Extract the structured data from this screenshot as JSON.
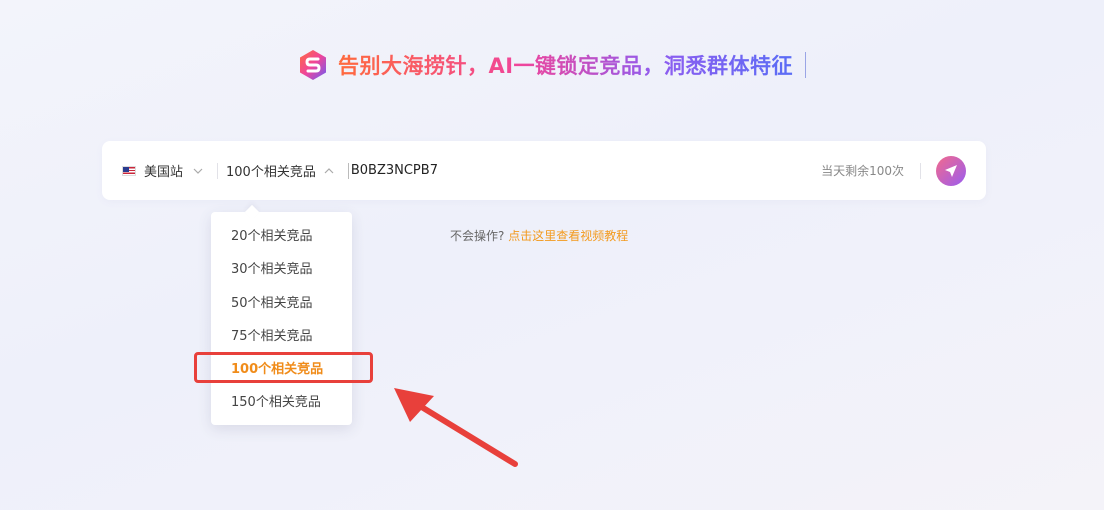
{
  "hero": {
    "title": "告别大海捞针，AI一键锁定竞品，洞悉群体特征",
    "logo_icon": "brand-s-logo-icon"
  },
  "search": {
    "site_label": "美国站",
    "site_flag_icon": "us-flag-icon",
    "count_label": "100个相关竞品",
    "asin_value": "B0BZ3NCPB7",
    "remaining_label": "当天剩余100次",
    "send_icon": "paper-plane-icon"
  },
  "help": {
    "prefix": "不会操作?",
    "link": "点击这里查看视频教程"
  },
  "dropdown": {
    "items": [
      {
        "label": "20个相关竞品"
      },
      {
        "label": "30个相关竞品"
      },
      {
        "label": "50个相关竞品"
      },
      {
        "label": "75个相关竞品"
      },
      {
        "label": "100个相关竞品"
      },
      {
        "label": "150个相关竞品"
      }
    ],
    "selected_index": 4
  },
  "colors": {
    "accent_orange": "#f08c1a",
    "highlight_red": "#e8403b",
    "send_gradient_start": "#f36a8c",
    "send_gradient_end": "#9a5cf0"
  }
}
